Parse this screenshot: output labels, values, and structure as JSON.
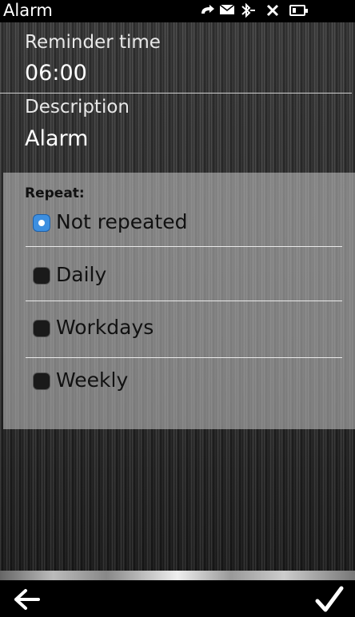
{
  "status_bar": {
    "app_title": "Alarm",
    "icons": [
      "signal-arrow-icon",
      "mail-icon",
      "bluetooth-icon",
      "no-signal-x-icon",
      "battery-icon"
    ]
  },
  "form": {
    "reminder_time": {
      "label": "Reminder time",
      "value": "06:00"
    },
    "description": {
      "label": "Description",
      "value": "Alarm"
    }
  },
  "repeat": {
    "title": "Repeat:",
    "options": [
      {
        "label": "Not repeated",
        "selected": true
      },
      {
        "label": "Daily",
        "selected": false
      },
      {
        "label": "Workdays",
        "selected": false
      },
      {
        "label": "Weekly",
        "selected": false
      }
    ]
  },
  "softkeys": {
    "left_icon": "back-arrow-icon",
    "right_icon": "checkmark-icon"
  },
  "colors": {
    "selected_radio": "#3d8fe0",
    "statusbar_bg": "#000000"
  }
}
